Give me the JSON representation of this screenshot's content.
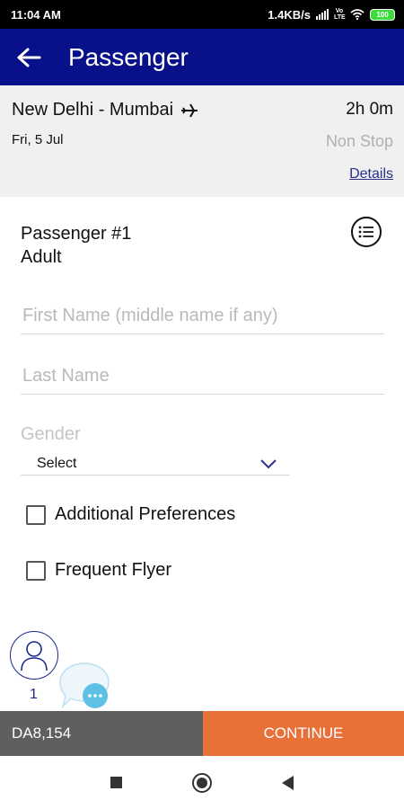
{
  "status_bar": {
    "time": "11:04 AM",
    "network_speed": "1.4KB/s",
    "signal_icon": "signal-icon",
    "volte_label": "Vo LTE",
    "wifi_icon": "wifi-icon",
    "battery_level": "100"
  },
  "app_bar": {
    "back_icon": "arrow-left-icon",
    "title": "Passenger",
    "color": "#08108a"
  },
  "flight": {
    "route": "New Delhi - Mumbai",
    "plane_icon": "airplane-icon",
    "duration": "2h 0m",
    "date": "Fri, 5 Jul",
    "stops": "Non Stop",
    "details_link": "Details"
  },
  "passenger": {
    "title": "Passenger #1",
    "type": "Adult",
    "list_icon": "list-icon",
    "first_name": {
      "value": "",
      "placeholder": "First Name (middle name if any)"
    },
    "last_name": {
      "value": "",
      "placeholder": "Last Name"
    },
    "gender": {
      "label": "Gender",
      "selected": "Select"
    },
    "additional_preferences": {
      "label": "Additional Preferences",
      "checked": false
    },
    "frequent_flyer": {
      "label": "Frequent Flyer",
      "checked": false
    }
  },
  "footer": {
    "passenger_count": "1",
    "avatar_icon": "user-icon",
    "chat_icon": "chat-bubble-icon",
    "price": "DA8,154",
    "continue_label": "CONTINUE",
    "accent": "#e8713a"
  },
  "nav": {
    "recents_icon": "square-icon",
    "home_icon": "circle-icon",
    "back_icon": "triangle-back-icon"
  }
}
